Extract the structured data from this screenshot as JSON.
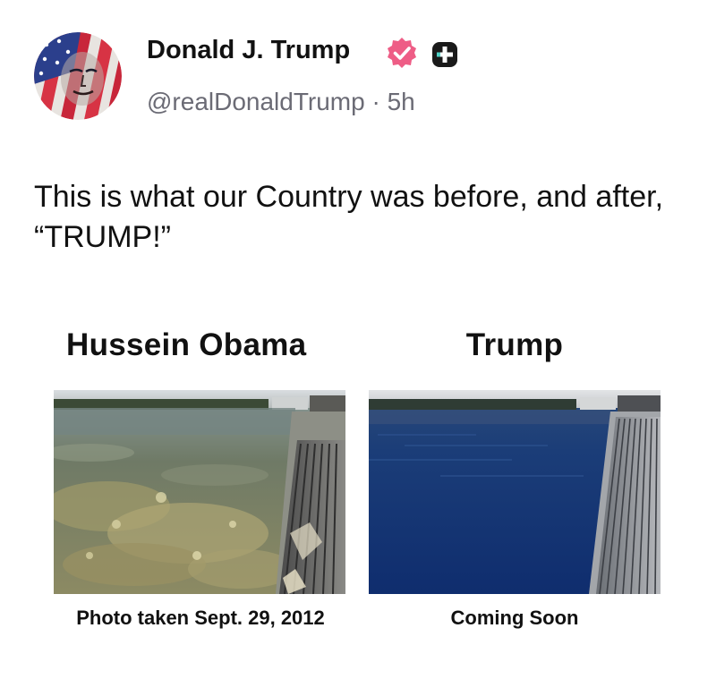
{
  "post": {
    "author": {
      "name": "Donald J. Trump",
      "handle": "@realDonaldTrump",
      "separator": "·",
      "time": "5h"
    },
    "text": "This is what our Country was before, and after, “TRUMP!”"
  },
  "meme": {
    "left": {
      "heading": "Hussein Obama",
      "caption": "Photo taken Sept. 29, 2012"
    },
    "right": {
      "heading": "Trump",
      "caption": "Coming Soon"
    }
  },
  "colors": {
    "verified_badge": "#ee5d86",
    "plus_badge": "#1a1a1a",
    "handle_text": "#6b6b75",
    "clear_water": "#1b3d78",
    "murky_water": "#6f7a66"
  },
  "icons": {
    "verified": "verified-badge-icon",
    "plus": "plus-badge-icon"
  }
}
